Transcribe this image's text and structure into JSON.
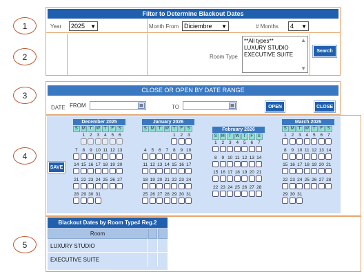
{
  "steps": [
    "1",
    "2",
    "3",
    "4",
    "5"
  ],
  "filter": {
    "title": "Filter to Determine Blackout Dates",
    "year_label": "Year",
    "year_value": "2025",
    "month_from_label": "Month From",
    "month_from_value": "Diciembre",
    "months_label": "# Months",
    "months_value": "4",
    "room_type_label": "Room Type",
    "room_types": [
      "**All types**",
      "LUXURY STUDIO",
      "EXECUTIVE SUITE"
    ],
    "search_label": "Search"
  },
  "range": {
    "title": "CLOSE OR OPEN BY DATE RANGE",
    "date_label": "DATE",
    "from_label": "FROM",
    "to_label": "TO",
    "open_label": "OPEN",
    "close_label": "CLOSE"
  },
  "calendar": {
    "save_label": "SAVE",
    "dow": [
      "S",
      "M",
      "T",
      "W",
      "T",
      "F",
      "S"
    ],
    "months": [
      {
        "title": "December 2025",
        "start": 1,
        "days": 31,
        "past_until": 6
      },
      {
        "title": "January 2026",
        "start": 4,
        "days": 31,
        "past_until": 0
      },
      {
        "title": "February 2026",
        "start": 0,
        "days": 28,
        "past_until": 0
      },
      {
        "title": "March 2026",
        "start": 0,
        "days": 31,
        "past_until": 0
      }
    ]
  },
  "blackout": {
    "title": "Blackout Dates by Room Type# Reg.2",
    "room_header": "Room",
    "rooms": [
      "LUXURY STUDIO",
      "EXECUTIVE SUITE"
    ]
  }
}
